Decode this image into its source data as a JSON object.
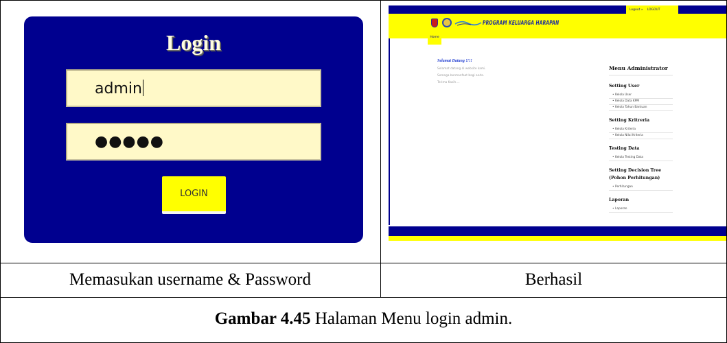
{
  "left_panel": {
    "title": "Login",
    "username_value": "admin",
    "password_mask": "●●●●●",
    "login_button": "LOGIN",
    "colors": {
      "card": "#00008f",
      "field": "#fff9c8",
      "button": "#ffff00"
    }
  },
  "right_panel": {
    "top_menu": [
      "Logout »",
      "LOGOUT"
    ],
    "brand_text": "PROGRAM KELUARGA HARAPAN",
    "home_tab": "Home",
    "welcome": {
      "title": "Selamat Datang !!!!",
      "lines": [
        "Selamat datang di website kami.",
        "Semoga bermanfaat bagi anda.",
        "Terima Kasih...."
      ]
    },
    "menu": {
      "heading": "Menu Administrator",
      "groups": [
        {
          "title": "Setting User",
          "items": [
            "Kelola User",
            "Kelola Data KPM",
            "Kelola Tahun Bantuan"
          ]
        },
        {
          "title": "Setting Kritreria",
          "items": [
            "Kelola Kriteria",
            "Kelola Nilai Kriteria"
          ]
        },
        {
          "title": "Testing Data",
          "items": [
            "Kelola Testing Data"
          ]
        },
        {
          "title": "Setting Decision Tree (Pohon Perhitungan)",
          "items": [
            "Perhitungan"
          ]
        },
        {
          "title": "Laporan",
          "items": [
            "Laporan"
          ]
        }
      ]
    },
    "colors": {
      "primary": "#00008f",
      "accent": "#ffff00"
    }
  },
  "captions": {
    "left": "Memasukan username & Password",
    "right": "Berhasil",
    "figure_label": "Gambar 4.45",
    "figure_text": " Halaman Menu login admin."
  }
}
